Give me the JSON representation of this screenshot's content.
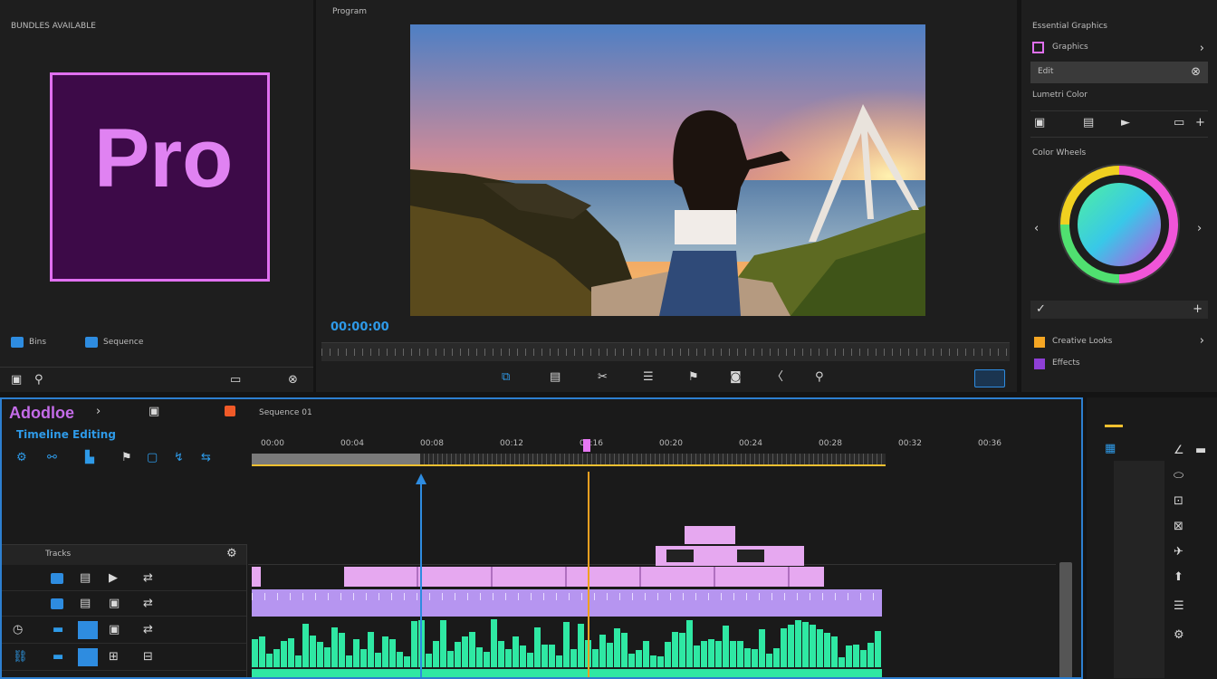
{
  "project_panel": {
    "top_label": "BUNDLES AVAILABLE",
    "logo_text": "Pro",
    "items": [
      {
        "label": "Bins"
      },
      {
        "label": "Sequence"
      }
    ]
  },
  "program_monitor": {
    "timecode": "00:00:00",
    "header_label": "Program"
  },
  "right_panel": {
    "header": "Essential Graphics",
    "items": [
      {
        "label": "Graphics"
      },
      {
        "label": "Edit"
      }
    ],
    "section": "Lumetri Color",
    "color_section": "Color Wheels",
    "bottom_items": [
      {
        "label": "Creative Looks",
        "color": "#f5a623"
      },
      {
        "label": "Effects",
        "color": "#8e3fd6"
      }
    ]
  },
  "timeline": {
    "app_title": "Adodloe",
    "subtitle": "Timeline Editing",
    "sequence_label": "Sequence 01",
    "ruler_labels": [
      "00:00",
      "00:04",
      "00:08",
      "00:12",
      "00:16",
      "00:20",
      "00:24",
      "00:28",
      "00:32",
      "00:36"
    ],
    "track_header": "Tracks"
  },
  "colors": {
    "accent": "#2d8ceb",
    "purple": "#c97ce6",
    "green": "#3fe0a0",
    "playhead": "#f0a020",
    "audio_teal": "#2fe8a3"
  }
}
